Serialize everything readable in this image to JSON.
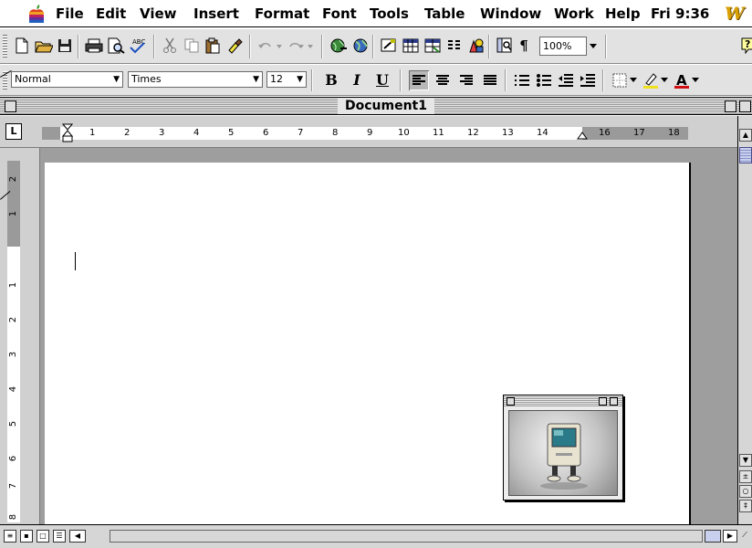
{
  "menubar": {
    "items": [
      "File",
      "Edit",
      "View",
      "Insert",
      "Format",
      "Font",
      "Tools",
      "Table",
      "Window",
      "Work",
      "Help"
    ],
    "clock": "Fri 9:36",
    "app_icon": "word-app-icon"
  },
  "toolbar": {
    "zoom_value": "100%"
  },
  "format_toolbar": {
    "style_value": "Normal",
    "font_value": "Times",
    "size_value": "12",
    "bold_label": "B",
    "italic_label": "I",
    "underline_label": "U",
    "font_color_label": "A"
  },
  "document": {
    "title": "Document1"
  },
  "ruler": {
    "horizontal_labels": [
      "1",
      "2",
      "3",
      "4",
      "5",
      "6",
      "7",
      "8",
      "9",
      "10",
      "11",
      "12",
      "13",
      "14",
      "16",
      "17",
      "18"
    ],
    "vertical_labels_top": [
      "2",
      "1"
    ],
    "vertical_labels_body": [
      "1",
      "2",
      "3",
      "4",
      "5",
      "6",
      "7",
      "8"
    ],
    "tab_button_label": "L"
  }
}
